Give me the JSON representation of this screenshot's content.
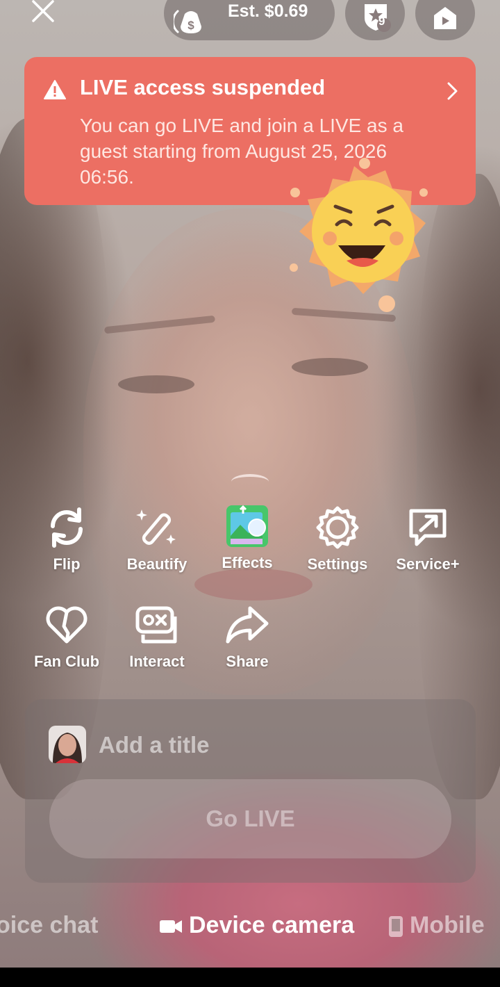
{
  "topbar": {
    "close_icon": "close-icon",
    "estimate_label": "Est. $0.69",
    "rank_badge_number": "9"
  },
  "banner": {
    "title": "LIVE access suspended",
    "message": "You can go LIVE and join a LIVE as a guest starting from August 25, 2026 06:56.",
    "color": "#ec6f63"
  },
  "tools": {
    "row1": [
      {
        "label": "Flip",
        "icon": "flip-camera-icon"
      },
      {
        "label": "Beautify",
        "icon": "magic-wand-icon"
      },
      {
        "label": "Effects",
        "icon": "effects-icon"
      },
      {
        "label": "Settings",
        "icon": "gear-icon"
      },
      {
        "label": "Service+",
        "icon": "service-plus-icon"
      }
    ],
    "row2": [
      {
        "label": "Fan Club",
        "icon": "heart-icon"
      },
      {
        "label": "Interact",
        "icon": "game-controller-icon"
      },
      {
        "label": "Share",
        "icon": "share-arrow-icon"
      }
    ]
  },
  "setup": {
    "title_placeholder": "Add a title",
    "go_live_label": "Go LIVE"
  },
  "modes": {
    "voice": "oice chat",
    "device": "Device camera",
    "mobile": "Mobile"
  }
}
